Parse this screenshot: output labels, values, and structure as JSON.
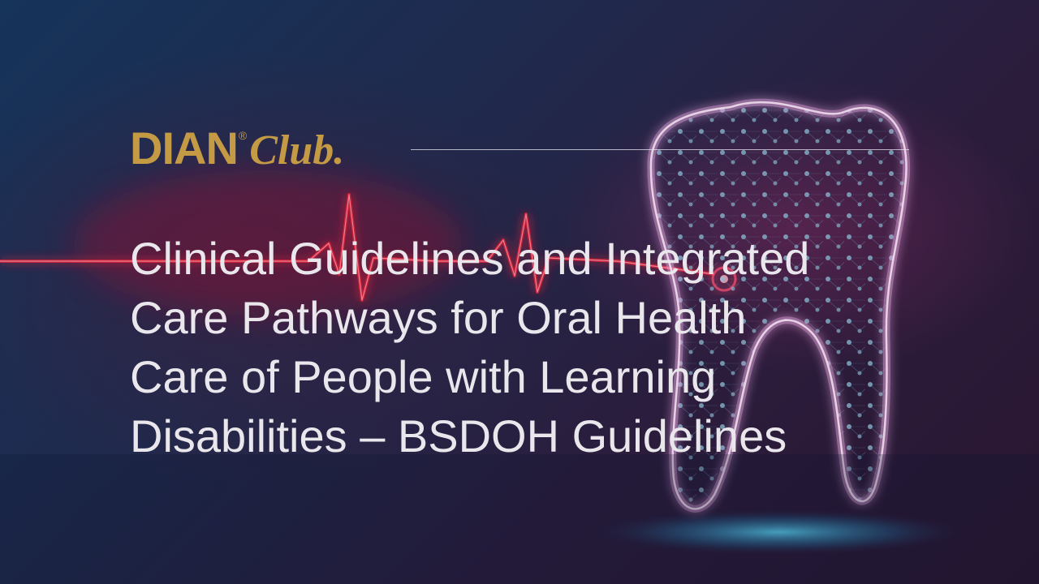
{
  "logo": {
    "brand": "DIAN",
    "registered_mark": "®",
    "suffix": "Club."
  },
  "title": "Clinical Guidelines and Integrated\nCare Pathways for Oral Health\nCare of People with Learning\nDisabilities – BSDOH Guidelines",
  "colors": {
    "logo_gold": "#c49a45",
    "title_text": "#e9e6ec",
    "tooth_glow": "#e6a8e0",
    "heartbeat_red": "#e0203a",
    "floor_glow": "#4fd0f0"
  },
  "icons": [
    "tooth-illustration",
    "heartbeat-line"
  ]
}
